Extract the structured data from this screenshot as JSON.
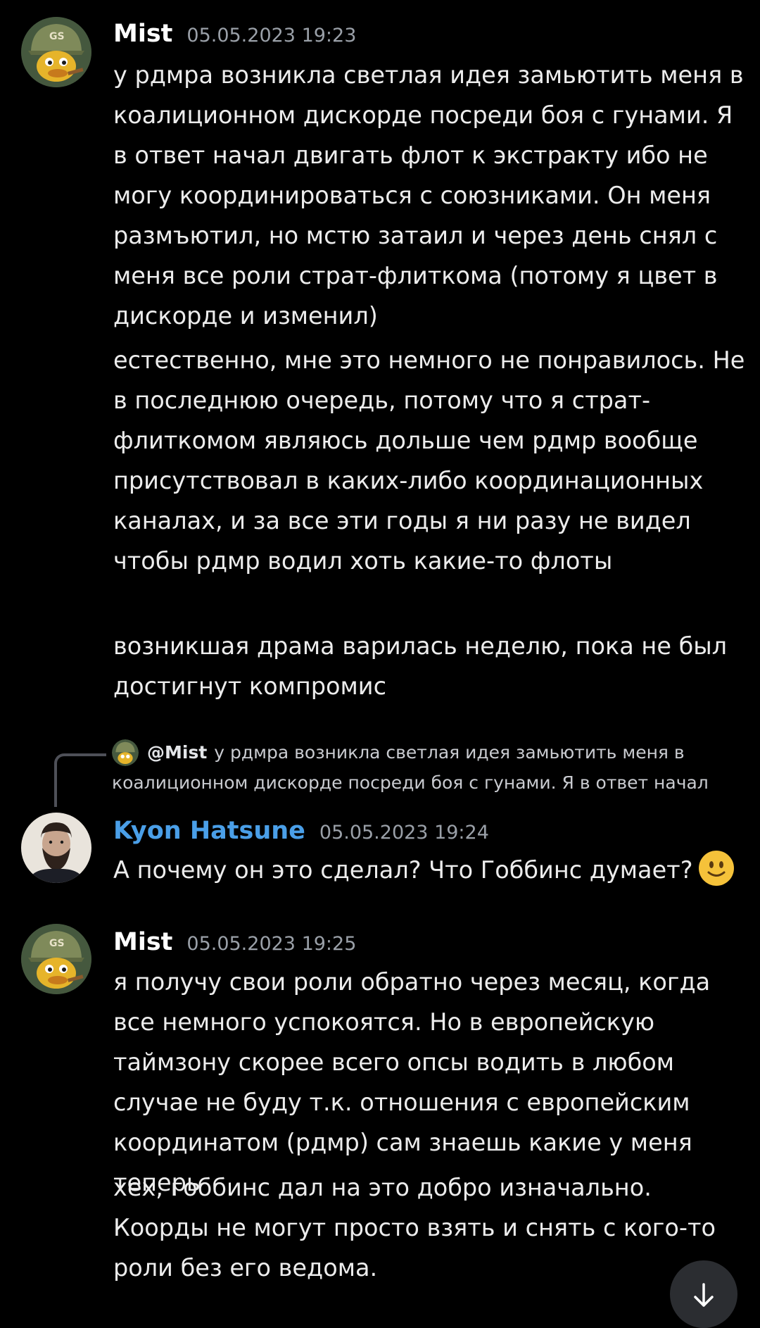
{
  "colors": {
    "background": "#000000",
    "username_default": "#ffffff",
    "username_kyon": "#4a9fe8",
    "timestamp": "#9aa0a8",
    "message_text": "#ececec"
  },
  "messages": [
    {
      "author": "Mist",
      "avatar_icon": "helmet-duck-avatar",
      "timestamp": "05.05.2023 19:23",
      "paragraphs": [
        "у рдмра возникла светлая идея замьютить меня в коалиционном дискорде посреди боя с гунами. Я в ответ начал двигать флот к экстракту ибо не могу координироваться с союзниками. Он меня размъютил, но мстю затаил и через день снял с меня все роли страт-флиткома (потому я цвет в дискорде и изменил)",
        "естественно, мне это немного не понравилось. Не в последнюю очередь, потому что я страт-флиткомом являюсь дольше чем рдмр вообще присутствовал в каких-либо координационных каналах, и за все эти годы я ни разу не видел чтобы рдмр водил хоть какие-то флоты",
        "возникшая драма варилась неделю, пока не был достигнут компромис"
      ]
    },
    {
      "author": "Kyon Hatsune",
      "avatar_icon": "bearded-man-avatar",
      "timestamp": "05.05.2023 19:24",
      "reply": {
        "author": "@Mist",
        "text": "у рдмра возникла светлая идея замьютить меня в коалиционном дискорде посреди боя с гунами. Я в ответ начал"
      },
      "text": "А почему он это сделал? Что Гоббинс думает?",
      "emoji": "slightly-smiling-face-icon"
    },
    {
      "author": "Mist",
      "avatar_icon": "helmet-duck-avatar",
      "timestamp": "05.05.2023 19:25",
      "paragraphs": [
        "я получу свои роли обратно через месяц, когда все немного успокоятся. Но в европейскую таймзону скорее всего опсы водить в любом случае не буду т.к. отношения с европейским координатом (рдмр) сам знаешь какие у меня теперь",
        "хех, гоббинс дал на это добро изначально. Коорды не могут просто взять и снять с кого-то роли без его ведома."
      ]
    }
  ],
  "scroll_button_icon": "arrow-down-icon"
}
